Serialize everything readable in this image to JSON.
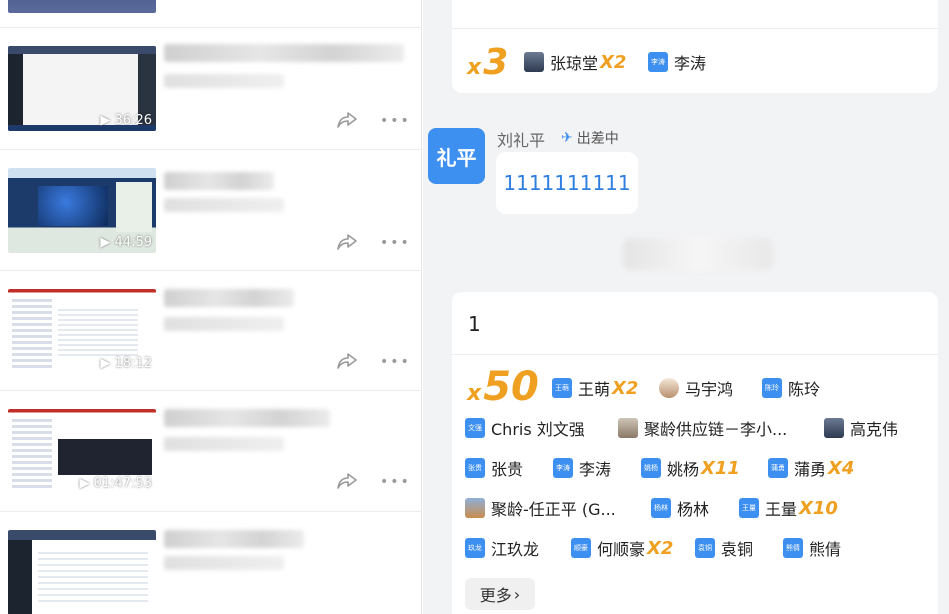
{
  "videos": [
    {
      "duration": "36:26"
    },
    {
      "duration": "44:59"
    },
    {
      "duration": "18:12"
    },
    {
      "duration": "01:47:53"
    }
  ],
  "left_more_glyph": "•••",
  "top_card": {
    "x_label": "x",
    "count": "3",
    "reactors": [
      {
        "name": "张琼堂",
        "mult": "X2",
        "avatar_text": ""
      },
      {
        "name": "李涛",
        "mult": "",
        "avatar_text": "李涛"
      }
    ]
  },
  "message": {
    "avatar_text": "礼平",
    "sender": "刘礼平",
    "status": "出差中",
    "content": "1111111111"
  },
  "reaction_card": {
    "content": "1",
    "x_label": "x",
    "count": "50",
    "reactors": [
      {
        "name": "王萌",
        "mult": "X2",
        "avatar_text": "王萌"
      },
      {
        "name": "马宇鸿",
        "mult": "",
        "avatar_text": ""
      },
      {
        "name": "陈玲",
        "mult": "",
        "avatar_text": "陈玲"
      },
      {
        "name": "Chris 刘文强",
        "mult": "",
        "avatar_text": "文强"
      },
      {
        "name": "聚龄供应链－李小...",
        "mult": "",
        "avatar_text": ""
      },
      {
        "name": "高克伟",
        "mult": "",
        "avatar_text": ""
      },
      {
        "name": "张贵",
        "mult": "",
        "avatar_text": "张贵"
      },
      {
        "name": "李涛",
        "mult": "",
        "avatar_text": "李涛"
      },
      {
        "name": "姚杨",
        "mult": "X11",
        "avatar_text": "姚杨"
      },
      {
        "name": "蒲勇",
        "mult": "X4",
        "avatar_text": "蒲勇"
      },
      {
        "name": "聚龄-任正平 (G...",
        "mult": "",
        "avatar_text": ""
      },
      {
        "name": "杨林",
        "mult": "",
        "avatar_text": "杨林"
      },
      {
        "name": "王量",
        "mult": "X10",
        "avatar_text": "王量"
      },
      {
        "name": "江玖龙",
        "mult": "",
        "avatar_text": "玖龙"
      },
      {
        "name": "何顺豪",
        "mult": "X2",
        "avatar_text": "顺豪"
      },
      {
        "name": "袁铜",
        "mult": "",
        "avatar_text": "袁铜"
      },
      {
        "name": "熊倩",
        "mult": "",
        "avatar_text": "熊倩"
      }
    ],
    "more_label": "更多",
    "more_chevron": "›"
  },
  "colors": {
    "accent": "#3d8ff0",
    "multiplier": "#f0a020",
    "link_text": "#2f7fe0"
  }
}
